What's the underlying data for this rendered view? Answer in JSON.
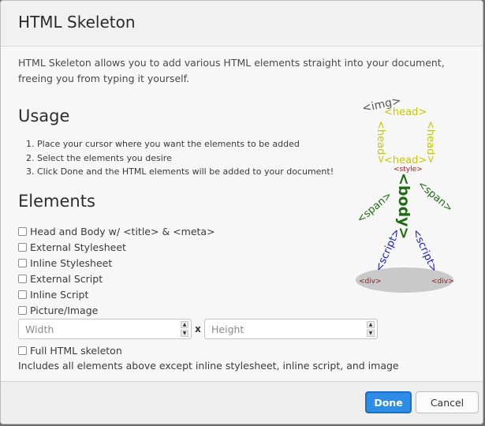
{
  "dialog": {
    "title": "HTML Skeleton",
    "intro": "HTML Skeleton allows you to add various HTML elements straight into your document, freeing you from typing it yourself."
  },
  "usage": {
    "heading": "Usage",
    "steps": [
      "Place your cursor where you want the elements to be added",
      "Select the elements you desire",
      "Click Done and the HTML elements will be added to your document!"
    ]
  },
  "elements": {
    "heading": "Elements",
    "options": [
      "Head and Body w/ <title> & <meta>",
      "External Stylesheet",
      "Inline Stylesheet",
      "External Script",
      "Inline Script",
      "Picture/Image"
    ],
    "width_placeholder": "Width",
    "height_placeholder": "Height",
    "times": "x",
    "full_skeleton": "Full HTML skeleton",
    "note": "Includes all elements above except inline stylesheet, inline script, and image"
  },
  "illustration": {
    "img": "<img>",
    "head": "<head>",
    "style": "<style>",
    "body": "<body>",
    "span": "<span>",
    "script": "<script>",
    "div": "<div>"
  },
  "buttons": {
    "done": "Done",
    "cancel": "Cancel"
  },
  "colors": {
    "accent": "#2f8ce6",
    "head": "#c8c800",
    "body": "#1e6b12",
    "script": "#1a1ac8",
    "div": "#8b1a1a"
  }
}
